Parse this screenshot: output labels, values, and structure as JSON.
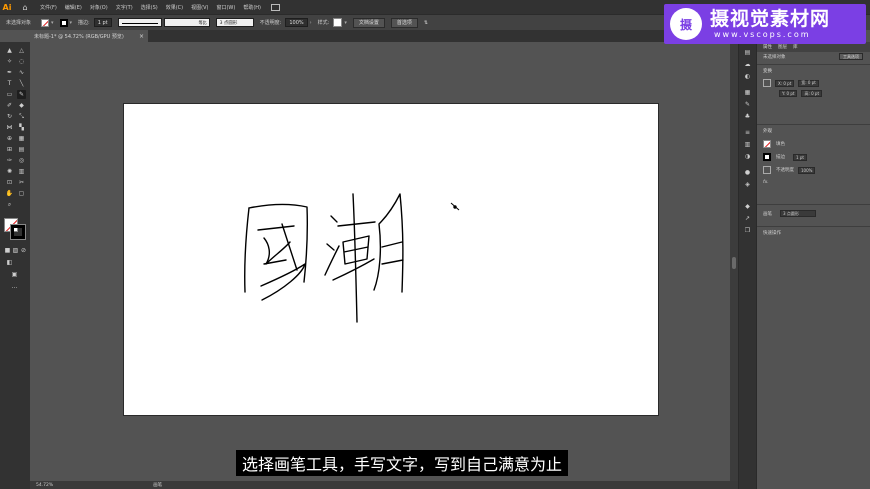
{
  "app": {
    "logo": "Ai",
    "menu": [
      "文件(F)",
      "编辑(E)",
      "对象(O)",
      "文字(T)",
      "选择(S)",
      "效果(C)",
      "视图(V)",
      "窗口(W)",
      "帮助(H)"
    ]
  },
  "control_bar": {
    "selection_label": "未选择对象",
    "stroke_label": "描边:",
    "stroke_weight": "1 pt",
    "uniform_label": "等比",
    "brush_name": "3 点圆形",
    "opacity_label": "不透明度:",
    "opacity_value": "100%",
    "style_label": "样式:",
    "doc_setup_button": "文档设置",
    "preferences_button": "首选项"
  },
  "document_tab": {
    "title": "未标题-1* @ 54.72% (RGB/GPU 预览)",
    "close": "×"
  },
  "status_bar": {
    "zoom": "54.72%",
    "tool_name": "画笔"
  },
  "right_panel": {
    "tabs": [
      "属性",
      "图层",
      "库"
    ],
    "no_selection": "未选择对象",
    "tool_options_button": "工具选项",
    "transform_header": "变换",
    "transform_x": "X: 0 pt",
    "transform_y": "Y: 0 pt",
    "transform_w": "宽: 0 pt",
    "transform_h": "高: 0 pt",
    "appearance_header": "外观",
    "fill_label": "填色",
    "stroke_label": "描边",
    "stroke_value": "1 pt",
    "opacity_label": "不透明度",
    "opacity_value": "100%",
    "fx_label": "fx.",
    "brush_label": "画笔",
    "brush_value": "3 点圆形",
    "quick_actions": "快速操作"
  },
  "subtitle": "选择画笔工具，手写文字，写到自己满意为止",
  "watermark": {
    "title": "摄视觉素材网",
    "url": "www.vscops.com",
    "logo_char": "摄"
  },
  "colors": {
    "accent": "#7b3fe4",
    "ai_orange": "#ff9a00",
    "canvas_bg": "#535353",
    "artboard": "#ffffff"
  }
}
